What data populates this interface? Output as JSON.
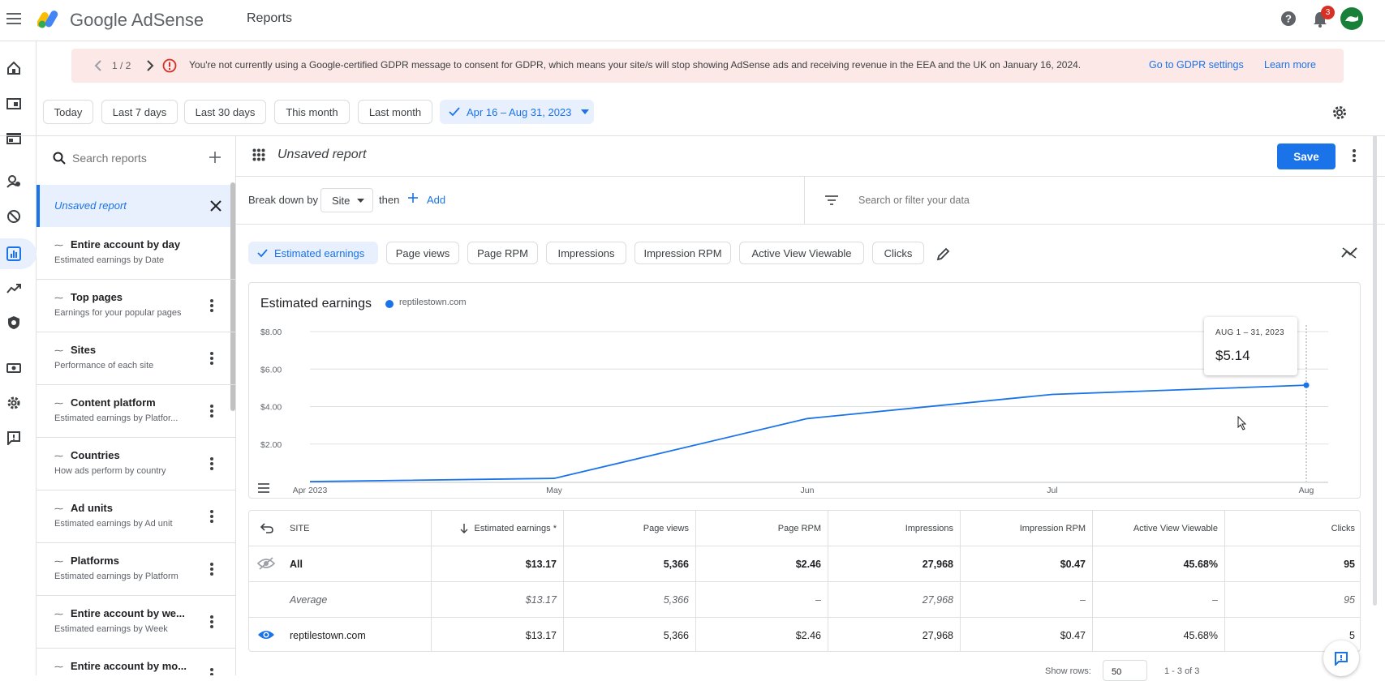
{
  "topbar": {
    "brand": "Google AdSense",
    "page": "Reports",
    "notif_count": "3"
  },
  "banner": {
    "pager": "1 / 2",
    "message": "You're not currently using a Google-certified GDPR message to consent for GDPR, which means your site/s will stop showing AdSense ads and receiving revenue in the EEA and the UK on January 16, 2024.",
    "action1": "Go to GDPR settings",
    "action2": "Learn more"
  },
  "dates": {
    "today": "Today",
    "last7": "Last 7 days",
    "last30": "Last 30 days",
    "this_month": "This month",
    "last_month": "Last month",
    "custom": "Apr 16 – Aug 31, 2023"
  },
  "sidebar": {
    "search_placeholder": "Search reports",
    "active": "Unsaved report",
    "items": [
      {
        "title": "Entire account by day",
        "sub": "Estimated earnings by Date"
      },
      {
        "title": "Top pages",
        "sub": "Earnings for your popular pages"
      },
      {
        "title": "Sites",
        "sub": "Performance of each site"
      },
      {
        "title": "Content platform",
        "sub": "Estimated earnings by Platfor..."
      },
      {
        "title": "Countries",
        "sub": "How ads perform by country"
      },
      {
        "title": "Ad units",
        "sub": "Estimated earnings by Ad unit"
      },
      {
        "title": "Platforms",
        "sub": "Estimated earnings by Platform"
      },
      {
        "title": "Entire account by we...",
        "sub": "Estimated earnings by Week"
      },
      {
        "title": "Entire account by mo...",
        "sub": ""
      }
    ]
  },
  "report": {
    "title": "Unsaved report",
    "save": "Save",
    "breakdown_label": "Break down by",
    "breakdown_value": "Site",
    "then": "then",
    "add": "Add",
    "filter_placeholder": "Search or filter your data"
  },
  "metrics": [
    "Estimated earnings",
    "Page views",
    "Page RPM",
    "Impressions",
    "Impression RPM",
    "Active View Viewable",
    "Clicks"
  ],
  "chart_data": {
    "type": "line",
    "title": "Estimated earnings",
    "series": [
      {
        "name": "reptilestown.com",
        "color": "#1a73e8",
        "x": [
          "Apr 2023",
          "May",
          "Jun",
          "Jul",
          "Aug"
        ],
        "values": [
          0.0,
          0.17,
          3.36,
          4.65,
          5.14
        ]
      }
    ],
    "ytick_labels": [
      "$8.00",
      "$6.00",
      "$4.00",
      "$2.00"
    ],
    "ylim": [
      0,
      8
    ],
    "tooltip": {
      "label": "AUG 1 – 31, 2023",
      "value": "$5.14"
    },
    "grid": true
  },
  "table": {
    "headers": [
      "SITE",
      "Estimated earnings *",
      "Page views",
      "Page RPM",
      "Impressions",
      "Impression RPM",
      "Active View Viewable",
      "Clicks"
    ],
    "rows": [
      {
        "cells": [
          "All",
          "$13.17",
          "5,366",
          "$2.46",
          "27,968",
          "$0.47",
          "45.68%",
          "95"
        ]
      },
      {
        "cells": [
          "Average",
          "$13.17",
          "5,366",
          "–",
          "27,968",
          "–",
          "–",
          "95"
        ]
      },
      {
        "cells": [
          "reptilestown.com",
          "$13.17",
          "5,366",
          "$2.46",
          "27,968",
          "$0.47",
          "45.68%",
          "5"
        ]
      }
    ]
  },
  "footer": {
    "show_rows": "Show rows:",
    "rows_value": "50",
    "range": "1 - 3 of 3"
  }
}
